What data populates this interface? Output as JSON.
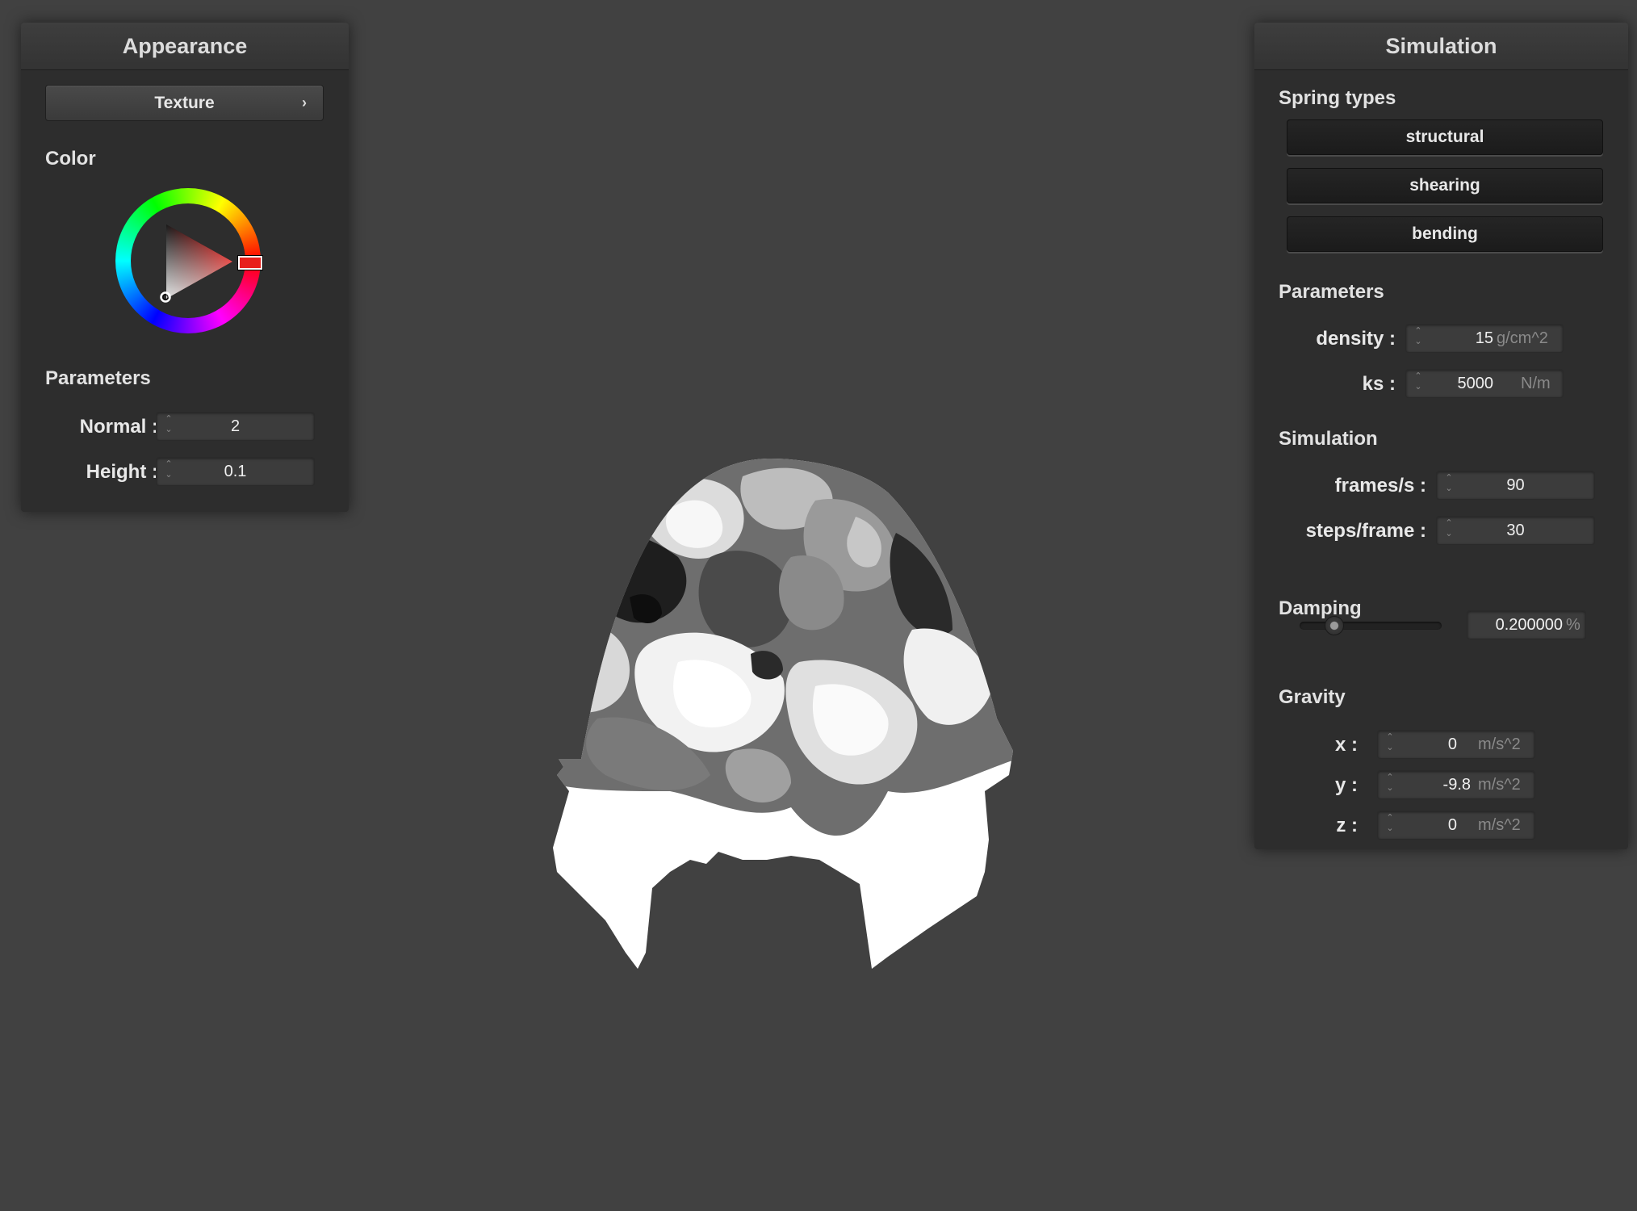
{
  "appearance": {
    "title": "Appearance",
    "texture_button": "Texture",
    "texture_chevron": "›",
    "color_label": "Color",
    "parameters_label": "Parameters",
    "normal_label": "Normal :",
    "normal_value": "2",
    "height_label": "Height :",
    "height_value": "0.1",
    "selected_color": "#e8201c"
  },
  "simulation": {
    "title": "Simulation",
    "spring_types_label": "Spring types",
    "spring_types": [
      "structural",
      "shearing",
      "bending"
    ],
    "parameters_label": "Parameters",
    "density_label": "density :",
    "density_value": "15",
    "density_unit": "g/cm^2",
    "ks_label": "ks :",
    "ks_value": "5000",
    "ks_unit": "N/m",
    "simulation_label": "Simulation",
    "fps_label": "frames/s :",
    "fps_value": "90",
    "steps_label": "steps/frame :",
    "steps_value": "30",
    "damping_label": "Damping",
    "damping_value": "0.200000",
    "damping_unit": "%",
    "damping_slider_fraction": 0.2,
    "gravity_label": "Gravity",
    "gx_label": "x :",
    "gx_value": "0",
    "gy_label": "y :",
    "gy_value": "-9.8",
    "gz_label": "z :",
    "gz_value": "0",
    "gravity_unit": "m/s^2"
  },
  "colors": {
    "background": "#414141",
    "panel": "#2d2d2d"
  }
}
